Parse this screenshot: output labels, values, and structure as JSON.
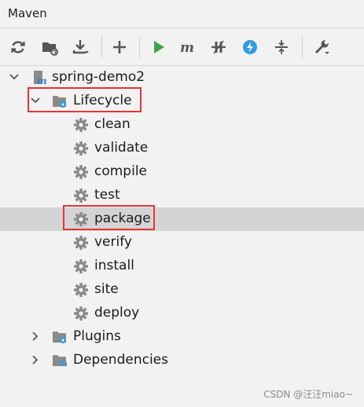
{
  "panel": {
    "title": "Maven"
  },
  "toolbar": {
    "buttons": [
      {
        "icon": "reload-icon",
        "name": "reload-projects-button"
      },
      {
        "icon": "generate-sources-icon",
        "name": "generate-sources-button"
      },
      {
        "icon": "download-icon",
        "name": "download-sources-button"
      },
      {
        "icon": "plus-icon",
        "name": "add-maven-project-button"
      },
      {
        "icon": "run-icon",
        "name": "run-maven-build-button"
      },
      {
        "icon": "maven-m-icon",
        "name": "execute-maven-goal-button"
      },
      {
        "icon": "toggle-offline-icon",
        "name": "toggle-offline-button"
      },
      {
        "icon": "skip-tests-icon",
        "name": "skip-tests-button"
      },
      {
        "icon": "collapse-all-icon",
        "name": "collapse-all-button"
      },
      {
        "icon": "wrench-icon",
        "name": "maven-settings-button"
      }
    ]
  },
  "tree": {
    "project": "spring-demo2",
    "lifecycle": {
      "label": "Lifecycle",
      "items": [
        "clean",
        "validate",
        "compile",
        "test",
        "package",
        "verify",
        "install",
        "site",
        "deploy"
      ],
      "selected": "package"
    },
    "plugins": "Plugins",
    "dependencies": "Dependencies"
  },
  "watermark": "CSDN @汪汪miao~",
  "colors": {
    "highlight": "#e33535",
    "selected_row": "#d4d4d4",
    "run_green": "#3fa34d",
    "skip_blue": "#2f9be5"
  }
}
